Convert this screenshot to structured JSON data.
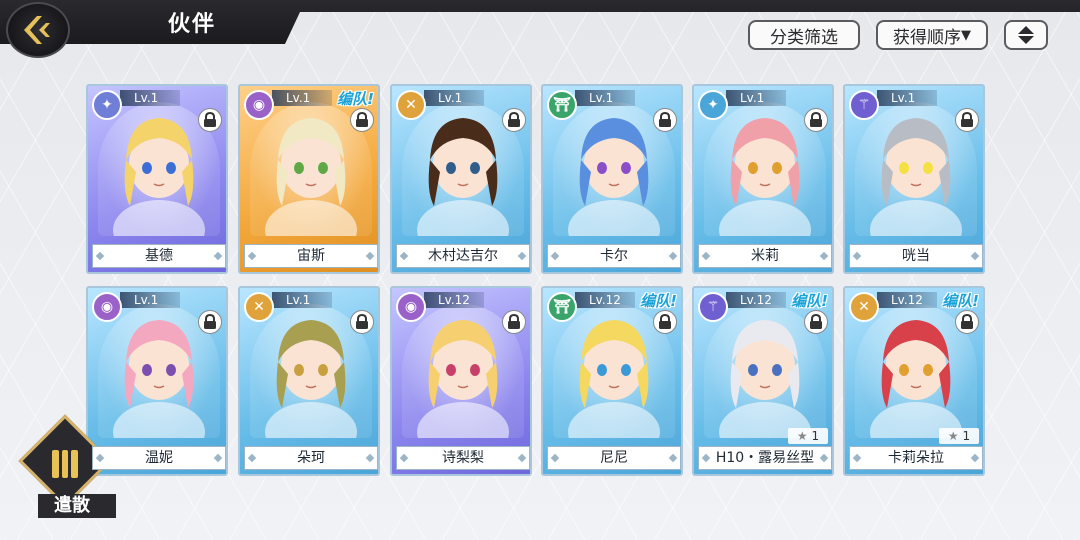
{
  "header": {
    "title": "伙伴",
    "filter_label": "分类筛选",
    "order_label": "获得顺序",
    "order_arrow": "▼",
    "direction_icon": "⇕"
  },
  "cards": [
    {
      "name": "基德",
      "level": "Lv.1",
      "rarity": "purple",
      "class_icon": "compass-icon",
      "class_color": "#6f7fd8",
      "team": "",
      "locked": true,
      "stars": "",
      "hair": "#f4d36a",
      "eyes": "#3b6fd6"
    },
    {
      "name": "宙斯",
      "level": "Lv.1",
      "rarity": "gold",
      "class_icon": "orb-icon",
      "class_color": "#9a62c9",
      "team": "编队!",
      "locked": true,
      "stars": "",
      "hair": "#f1e8c4",
      "eyes": "#5fa846"
    },
    {
      "name": "木村达吉尔",
      "level": "Lv.1",
      "rarity": "blue",
      "class_icon": "swords-icon",
      "class_color": "#e0a23a",
      "team": "",
      "locked": true,
      "stars": "",
      "hair": "#4a2c1a",
      "eyes": "#2f5d8c"
    },
    {
      "name": "卡尔",
      "level": "Lv.1",
      "rarity": "blue",
      "class_icon": "gate-icon",
      "class_color": "#3aa56a",
      "team": "",
      "locked": true,
      "stars": "",
      "hair": "#5a8fe0",
      "eyes": "#8a4fc8"
    },
    {
      "name": "米莉",
      "level": "Lv.1",
      "rarity": "blue",
      "class_icon": "compass-icon",
      "class_color": "#4aa5d8",
      "team": "",
      "locked": true,
      "stars": "",
      "hair": "#f0a0a8",
      "eyes": "#e0a030"
    },
    {
      "name": "咣当",
      "level": "Lv.1",
      "rarity": "blue",
      "class_icon": "spear-icon",
      "class_color": "#6f5fd0",
      "team": "",
      "locked": true,
      "stars": "",
      "hair": "#b8bcc4",
      "eyes": "#f4e040"
    },
    {
      "name": "温妮",
      "level": "Lv.1",
      "rarity": "blue",
      "class_icon": "orb-icon",
      "class_color": "#9a62c9",
      "team": "",
      "locked": true,
      "stars": "",
      "hair": "#f4a8c0",
      "eyes": "#7a4fb0"
    },
    {
      "name": "朵珂",
      "level": "Lv.1",
      "rarity": "blue",
      "class_icon": "swords-icon",
      "class_color": "#e0a23a",
      "team": "",
      "locked": true,
      "stars": "",
      "hair": "#a8a050",
      "eyes": "#c8a040"
    },
    {
      "name": "诗梨梨",
      "level": "Lv.12",
      "rarity": "purple",
      "class_icon": "orb-icon",
      "class_color": "#9a62c9",
      "team": "",
      "locked": true,
      "stars": "",
      "hair": "#f6d070",
      "eyes": "#c8406a"
    },
    {
      "name": "尼尼",
      "level": "Lv.12",
      "rarity": "blue",
      "class_icon": "gate-icon",
      "class_color": "#3aa56a",
      "team": "编队!",
      "locked": true,
      "stars": "",
      "hair": "#f4d860",
      "eyes": "#3a9ad8"
    },
    {
      "name": "H10・露易丝型",
      "level": "Lv.12",
      "rarity": "blue",
      "class_icon": "spear-icon",
      "class_color": "#6f5fd0",
      "team": "编队!",
      "locked": true,
      "stars": "1",
      "hair": "#e8eaf0",
      "eyes": "#4a70c0"
    },
    {
      "name": "卡莉朵拉",
      "level": "Lv.12",
      "rarity": "blue",
      "class_icon": "swords-icon",
      "class_color": "#e0a23a",
      "team": "编队!",
      "locked": false,
      "stars": "1",
      "hair": "#d8404a",
      "eyes": "#e0a030"
    }
  ],
  "dismiss": {
    "label": "遣散"
  }
}
